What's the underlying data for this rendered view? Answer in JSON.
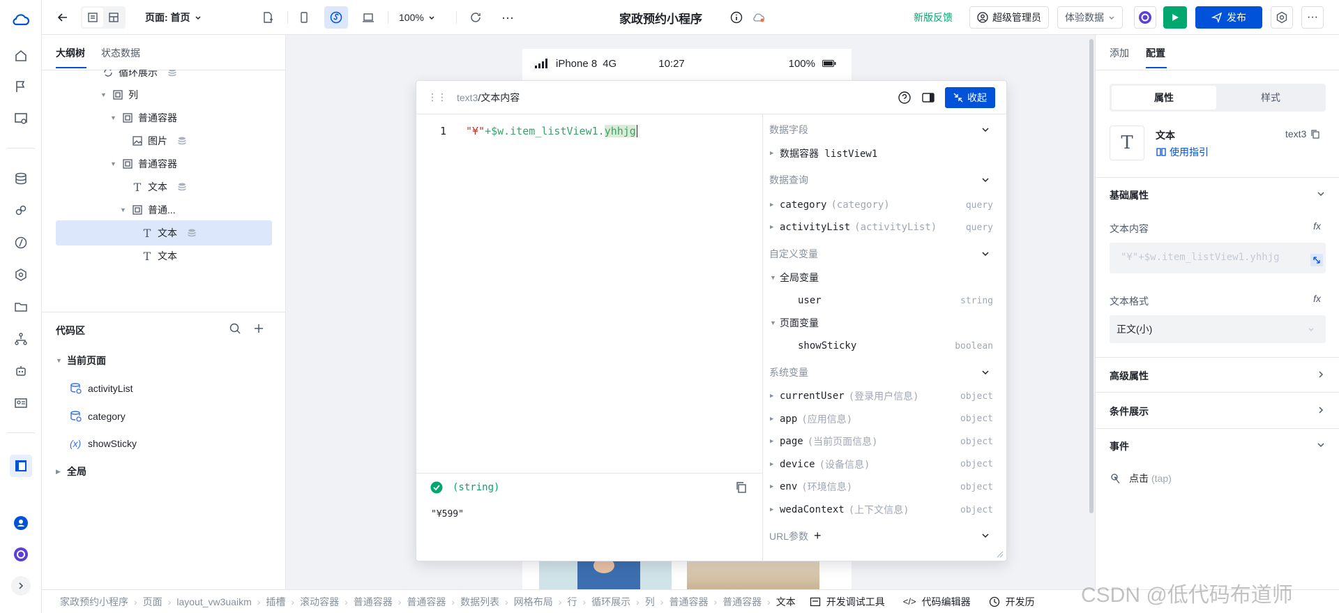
{
  "topbar": {
    "page_label": "页面: 首页",
    "zoom": "100%",
    "app_title": "家政预约小程序",
    "feedback": "新版反馈",
    "admin": "超级管理员",
    "data_mode": "体验数据",
    "publish": "发布"
  },
  "left": {
    "tab_outline": "大纲树",
    "tab_state": "状态数据",
    "tree": [
      {
        "label": "循环展示",
        "icon": "loop-icon",
        "indent": 0
      },
      {
        "label": "列",
        "icon": "container-icon",
        "indent": 1
      },
      {
        "label": "普通容器",
        "icon": "container-icon",
        "indent": 2
      },
      {
        "label": "图片",
        "icon": "image-icon",
        "indent": 3
      },
      {
        "label": "普通容器",
        "icon": "container-icon",
        "indent": 2
      },
      {
        "label": "文本",
        "icon": "text-icon",
        "indent": 3
      },
      {
        "label": "普通...",
        "icon": "container-icon",
        "indent": 3
      },
      {
        "label": "文本",
        "icon": "text-icon",
        "indent": 4
      },
      {
        "label": "文本",
        "icon": "text-icon",
        "indent": 4
      }
    ],
    "code_title": "代码区",
    "current_page": "当前页面",
    "code_items": [
      "activityList",
      "category",
      "showSticky"
    ],
    "global": "全局"
  },
  "phone": {
    "device": "iPhone 8",
    "network": "4G",
    "time": "10:27",
    "battery": "100%"
  },
  "editor": {
    "crumb_parent": "text3",
    "crumb_child": "/文本内容",
    "collapse": "收起",
    "line_no": "1",
    "code_str": "\"¥\"",
    "code_plus": "+$w.item_listView1.",
    "code_hl": "yhhjg",
    "result_type": "(string)",
    "result_value": "\"¥599\"",
    "sections": {
      "data_fields": "数据字段",
      "data_query": "数据查询",
      "custom_vars": "自定义变量",
      "system_vars": "系统变量",
      "url_params": "URL参数"
    },
    "data_field_item": "数据容器 listView1",
    "queries": [
      {
        "name": "category",
        "sub": "(category)",
        "type": "query"
      },
      {
        "name": "activityList",
        "sub": "(activityList)",
        "type": "query"
      }
    ],
    "global_vars_label": "全局变量",
    "global_vars": [
      {
        "name": "user",
        "type": "string"
      }
    ],
    "page_vars_label": "页面变量",
    "page_vars": [
      {
        "name": "showSticky",
        "type": "boolean"
      }
    ],
    "system_vars": [
      {
        "name": "currentUser",
        "sub": "(登录用户信息)",
        "type": "object"
      },
      {
        "name": "app",
        "sub": "(应用信息)",
        "type": "object"
      },
      {
        "name": "page",
        "sub": "(当前页面信息)",
        "type": "object"
      },
      {
        "name": "device",
        "sub": "(设备信息)",
        "type": "object"
      },
      {
        "name": "env",
        "sub": "(环境信息)",
        "type": "object"
      },
      {
        "name": "wedaContext",
        "sub": "(上下文信息)",
        "type": "object"
      }
    ]
  },
  "right": {
    "tab_add": "添加",
    "tab_config": "配置",
    "seg_props": "属性",
    "seg_style": "样式",
    "comp_name": "文本",
    "comp_id": "text3",
    "guide": "使用指引",
    "basic": "基础属性",
    "text_content": "文本内容",
    "text_content_value": "\"¥\"+$w.item_listView1.yhhjg",
    "text_format": "文本格式",
    "text_format_value": "正文(小)",
    "advanced": "高级属性",
    "conditional": "条件展示",
    "events": "事件",
    "event_click": "点击",
    "event_click_sub": "(tap)"
  },
  "bottom": {
    "crumbs": [
      "家政预约小程序",
      "页面",
      "layout_vw3uaikm",
      "插槽",
      "滚动容器",
      "普通容器",
      "普通容器",
      "数据列表",
      "网格布局",
      "行",
      "循环展示",
      "列",
      "普通容器",
      "普通容器",
      "文本"
    ],
    "dev_tools": "开发调试工具",
    "code_editor": "代码编辑器",
    "dev_history": "开发历",
    "watermark": "CSDN @低代码布道师"
  },
  "colors": {
    "primary": "#0052d9",
    "selected": "#dce7fb",
    "green": "#00a870",
    "code_green": "#3aa26a",
    "code_red": "#c4372a"
  }
}
